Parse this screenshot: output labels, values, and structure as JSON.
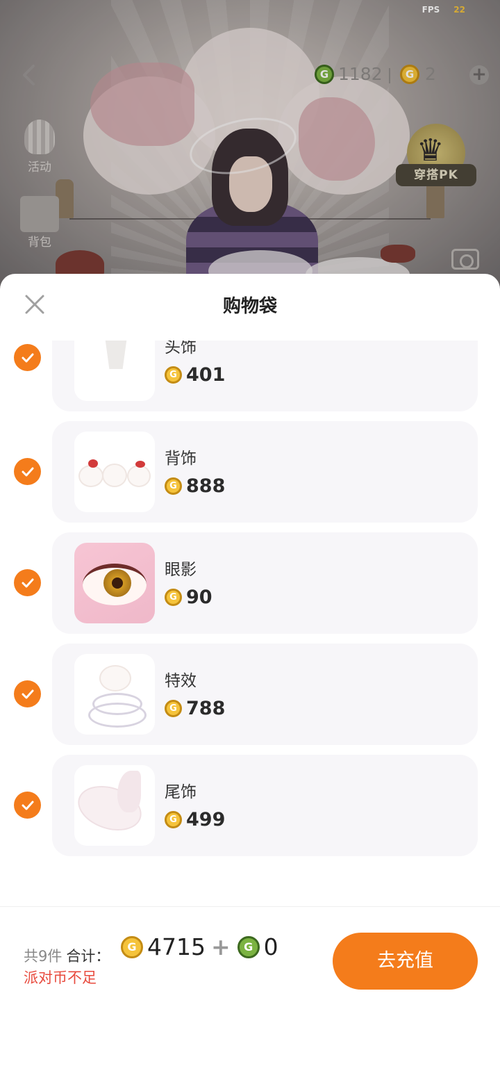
{
  "status": {
    "fps_label": "FPS",
    "fps_value": "22"
  },
  "topbar": {
    "green_coins": "1182",
    "gold_coins": "2",
    "activity_label": "活动",
    "gift_label": "背包",
    "pk_label": "穿搭PK"
  },
  "sheet": {
    "title": "购物袋",
    "items": [
      {
        "name": "头饰",
        "price": "401",
        "checked": true
      },
      {
        "name": "背饰",
        "price": "888",
        "checked": true
      },
      {
        "name": "眼影",
        "price": "90",
        "checked": true
      },
      {
        "name": "特效",
        "price": "788",
        "checked": true
      },
      {
        "name": "尾饰",
        "price": "499",
        "checked": true
      }
    ]
  },
  "footer": {
    "count_text": "共9件",
    "total_label": "合计：",
    "gold_total": "4715",
    "plus": "+",
    "green_total": "0",
    "warning": "派对币不足",
    "recharge_button": "去充值"
  },
  "colors": {
    "accent": "#f47c1b",
    "warning": "#e84a3d",
    "card_bg": "#f7f6f9"
  },
  "icons": {
    "close": "close-icon",
    "check": "check-icon",
    "gold_coin": "gold-coin-icon",
    "green_coin": "green-coin-icon",
    "back": "back-arrow-icon",
    "camera": "camera-icon",
    "plus": "plus-icon"
  }
}
